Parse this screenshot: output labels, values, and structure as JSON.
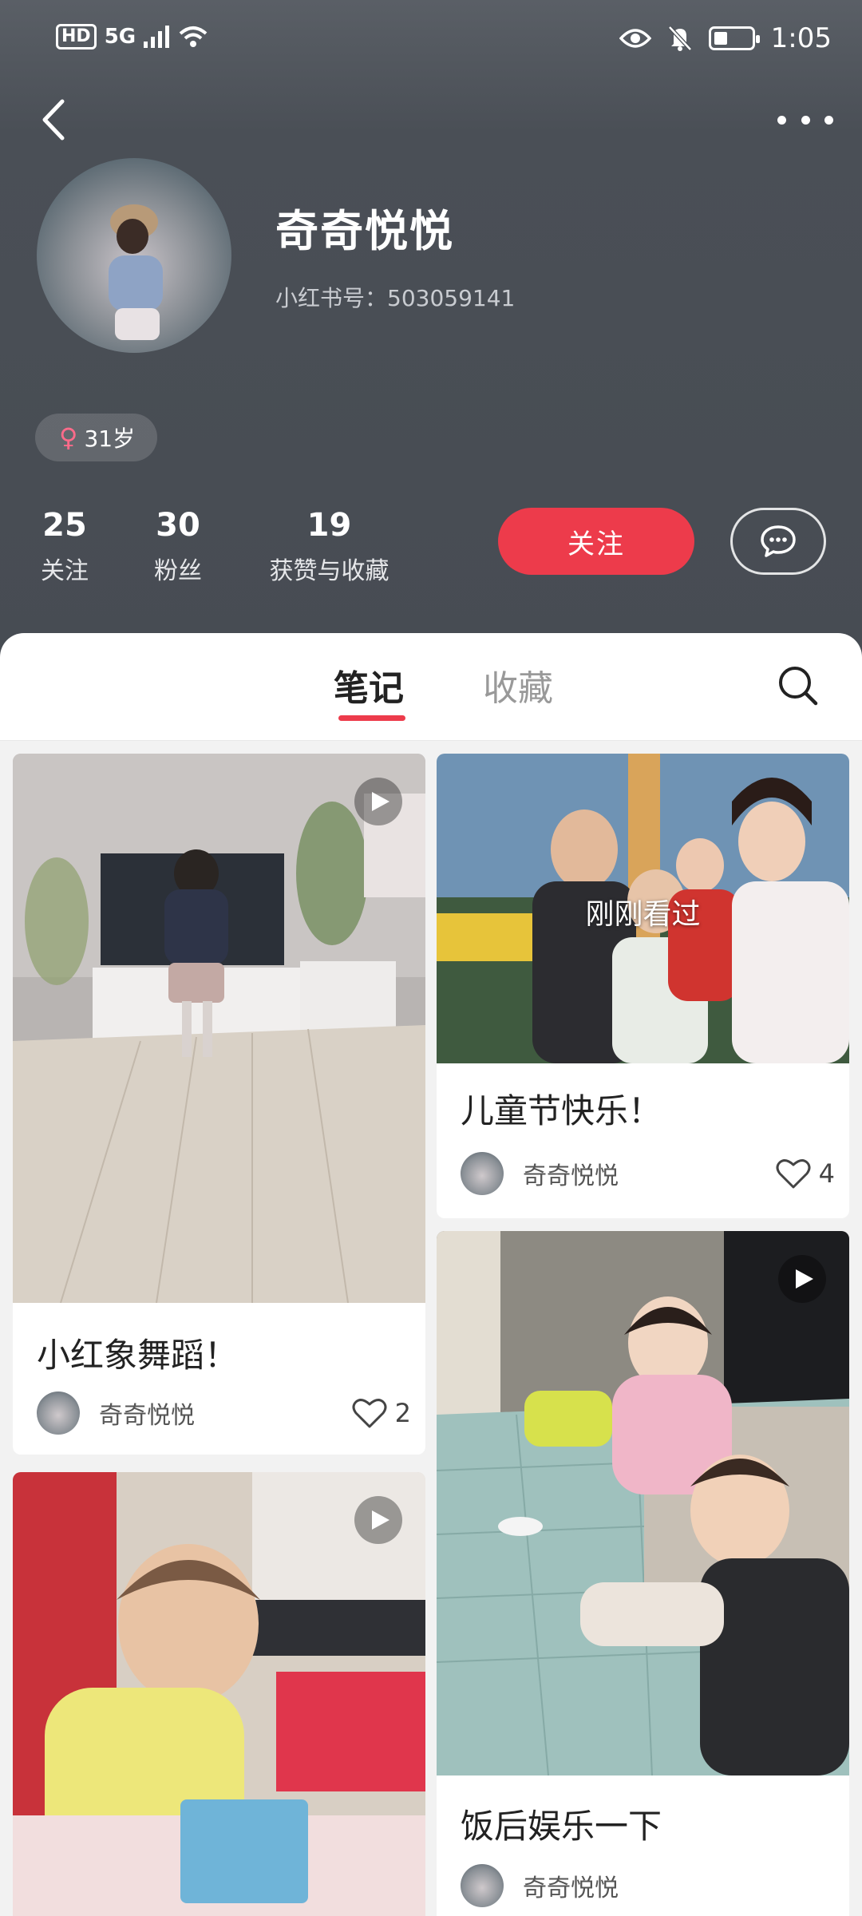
{
  "status_bar": {
    "hd": "HD",
    "network": "5G",
    "time": "1:05"
  },
  "profile": {
    "name": "奇奇悦悦",
    "id_label": "小红书号：",
    "id_value": "503059141",
    "gender_symbol": "♀",
    "age": "31岁",
    "stats": [
      {
        "num": "25",
        "label": "关注"
      },
      {
        "num": "30",
        "label": "粉丝"
      },
      {
        "num": "19",
        "label": "获赞与收藏"
      }
    ],
    "follow_label": "关注"
  },
  "tabs": {
    "notes": "笔记",
    "favorites": "收藏"
  },
  "notes": [
    {
      "title": "小红象舞蹈！",
      "author": "奇奇悦悦",
      "likes": "2",
      "is_video": true
    },
    {
      "title": "儿童节快乐！",
      "author": "奇奇悦悦",
      "likes": "4",
      "is_video": false,
      "overlay": "刚刚看过"
    },
    {
      "title": "",
      "author": "",
      "likes": "",
      "is_video": true
    },
    {
      "title": "饭后娱乐一下",
      "author": "奇奇悦悦",
      "likes": "",
      "is_video": true
    }
  ],
  "colors": {
    "accent": "#ed3b4b",
    "header_bg": "#4a4f56",
    "female": "#ff6b8a"
  }
}
